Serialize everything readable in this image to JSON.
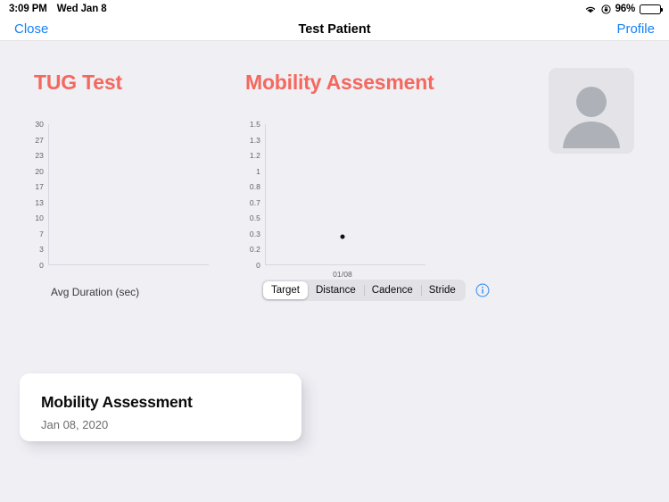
{
  "status_bar": {
    "time": "3:09 PM",
    "date": "Wed Jan 8",
    "battery_percent": "96%",
    "battery_level": 96,
    "icons": [
      "wifi-icon",
      "rotation-lock-icon",
      "battery-icon"
    ]
  },
  "nav_bar": {
    "close_label": "Close",
    "title": "Test Patient",
    "profile_label": "Profile"
  },
  "tug_panel": {
    "title": "TUG Test",
    "axis_label": "Avg Duration (sec)"
  },
  "mobility_panel": {
    "title": "Mobility Assesment",
    "segments": [
      {
        "label": "Target",
        "selected": true
      },
      {
        "label": "Distance",
        "selected": false
      },
      {
        "label": "Cadence",
        "selected": false
      },
      {
        "label": "Stride",
        "selected": false
      }
    ],
    "info_icon": "info-circle-icon"
  },
  "avatar": {
    "icon": "person-placeholder-icon"
  },
  "record_card": {
    "title": "Mobility Assessment",
    "date": "Jan 08, 2020"
  },
  "colors": {
    "background": "#EFEFF4",
    "accent": "#F4685E",
    "link": "#1580F5",
    "axis": "#D7D7DF",
    "point": "#111111"
  },
  "chart_data": [
    {
      "type": "scatter",
      "title": "TUG Test",
      "xlabel": "Avg Duration (sec)",
      "ylabel": "",
      "yticks": [
        30,
        27,
        23,
        20,
        17,
        13,
        10,
        7,
        3,
        0
      ],
      "ylim": [
        0,
        30
      ],
      "xticks": [],
      "x": [],
      "values": [],
      "grid": false,
      "legend": "none"
    },
    {
      "type": "scatter",
      "title": "Mobility Assesment",
      "xlabel": "",
      "ylabel": "",
      "yticks": [
        1.5,
        1.3,
        1.2,
        1.0,
        0.8,
        0.7,
        0.5,
        0.3,
        0.2,
        0.0
      ],
      "ylim": [
        0.0,
        1.5
      ],
      "xticks": [
        "01/08"
      ],
      "series": [
        {
          "name": "Target",
          "x": [
            "01/08"
          ],
          "values": [
            0.3
          ]
        }
      ],
      "grid": false,
      "legend": "none"
    }
  ]
}
